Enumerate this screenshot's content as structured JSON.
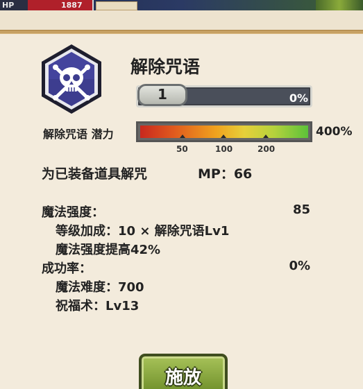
{
  "status_bar": {
    "hp_label": "HP",
    "hp_value": "1887"
  },
  "skill": {
    "icon": "skull-crossbones-icon",
    "name": "解除咒语",
    "level": "1",
    "progress_text": "0%",
    "progress_fraction": 0.0
  },
  "potential": {
    "label": "解除咒语 潜力",
    "max_label": "400%",
    "ticks": [
      "50",
      "100",
      "200"
    ]
  },
  "description": {
    "text": "为已装备道具解咒",
    "mp": "MP：66"
  },
  "stats": {
    "magic_power_label": "魔法强度：",
    "magic_power_value": "85",
    "level_bonus": "等级加成：10 × 解除咒语Lv1",
    "power_increase": "魔法强度提高42%",
    "success_rate_label": "成功率：",
    "success_rate_value": "0%",
    "difficulty": "魔法难度：700",
    "blessing": "祝福术：Lv13"
  },
  "actions": {
    "cast_label": "施放"
  },
  "colors": {
    "panel_bg": "#f3ebdc",
    "header_line": "#c6a063",
    "icon_bg": "#3d3d8f",
    "cast_button": "#8aab3c"
  }
}
